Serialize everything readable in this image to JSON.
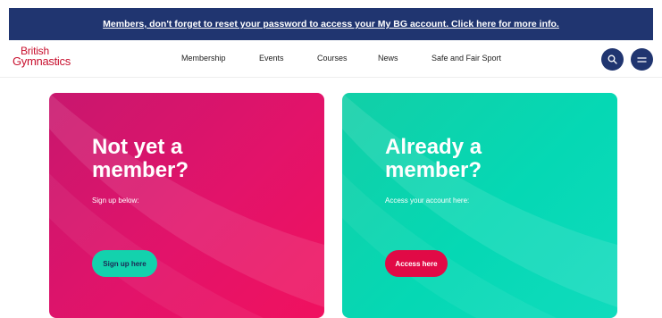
{
  "banner": {
    "text": "Members, don't forget to reset your password to access your My BG account. Click here for more info."
  },
  "logo": {
    "line1": "British",
    "line2": "Gymnastics"
  },
  "nav": {
    "items": [
      {
        "label": "Membership"
      },
      {
        "label": "Events"
      },
      {
        "label": "Courses"
      },
      {
        "label": "News"
      },
      {
        "label": "Safe and Fair Sport"
      }
    ],
    "search_icon": "search-icon",
    "menu_icon": "hamburger-menu-icon"
  },
  "cards": {
    "left": {
      "title": "Not yet a\nmember?",
      "subtitle": "Sign up below:",
      "button": "Sign up here"
    },
    "right": {
      "title": "Already a\nmember?",
      "subtitle": "Access your account here:",
      "button": "Access here"
    }
  },
  "colors": {
    "navy": "#203570",
    "brand_red": "#c8102e",
    "pink": "#e2136a",
    "teal": "#05d8b4",
    "access_red": "#e10a46"
  }
}
